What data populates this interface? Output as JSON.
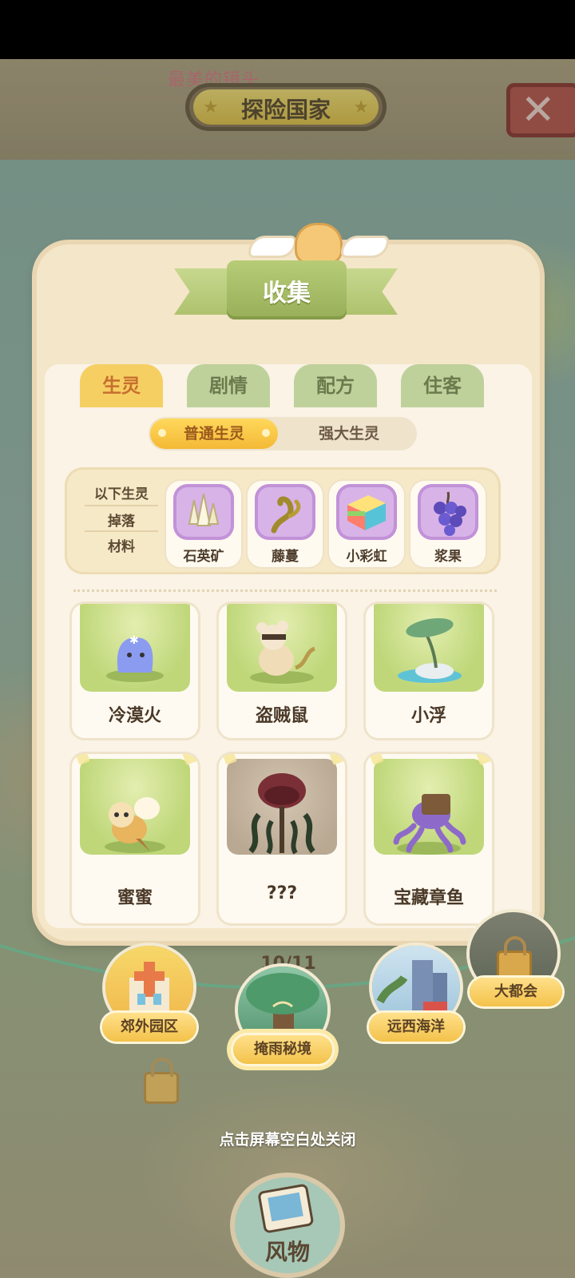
{
  "header": {
    "subtitle": "最美的镜头",
    "title": "探险国家"
  },
  "panel": {
    "title": "收集",
    "tabs": [
      {
        "label": "生灵",
        "active": true
      },
      {
        "label": "剧情",
        "active": false
      },
      {
        "label": "配方",
        "active": false
      },
      {
        "label": "住客",
        "active": false
      }
    ],
    "segments": [
      "普通生灵",
      "强大生灵"
    ],
    "drops": {
      "lines": [
        "以下生灵",
        "掉落",
        "材料"
      ],
      "materials": [
        {
          "name": "石英矿",
          "icon": "quartz-icon"
        },
        {
          "name": "藤蔓",
          "icon": "vine-icon"
        },
        {
          "name": "小彩虹",
          "icon": "rainbow-block-icon"
        },
        {
          "name": "浆果",
          "icon": "berry-icon"
        }
      ]
    },
    "creatures": [
      {
        "name": "冷漠火"
      },
      {
        "name": "盗贼鼠"
      },
      {
        "name": "小浮"
      },
      {
        "name": "蜜蜜"
      },
      {
        "name": "???"
      },
      {
        "name": "宝藏章鱼"
      }
    ],
    "count": "10/11"
  },
  "regions": [
    {
      "name": "郊外园区"
    },
    {
      "name": "掩雨秘境"
    },
    {
      "name": "远西海洋"
    },
    {
      "name": "大都会"
    }
  ],
  "hint": "点击屏幕空白处关闭",
  "bottom_button": "风物"
}
